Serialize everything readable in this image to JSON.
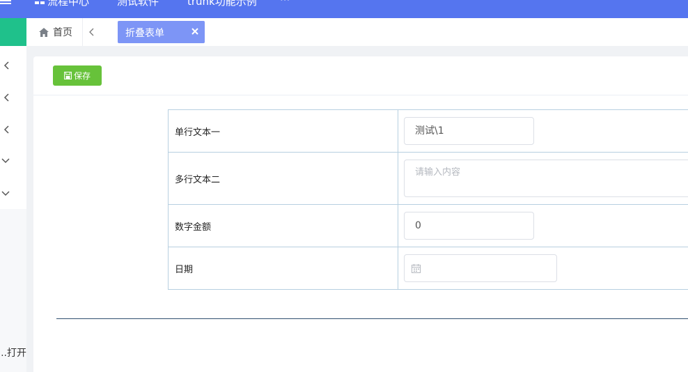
{
  "topbar": {
    "menu": [
      "流程中心",
      "测试软件",
      "trunk功能示例",
      "···"
    ]
  },
  "tabs": {
    "home_label": "首页",
    "active_label": "折叠表单"
  },
  "toolbar": {
    "save_label": "保存"
  },
  "form": {
    "rows": [
      {
        "label": "单行文本一",
        "value": "测试\\1"
      },
      {
        "label": "多行文本二",
        "placeholder": "请输入内容"
      },
      {
        "label": "数字金额",
        "value": "0"
      },
      {
        "label": "日期",
        "value": ""
      }
    ]
  },
  "sidebar": {
    "bottom_text": "打开..."
  },
  "colors": {
    "topbar": "#5575ef",
    "active_tab": "#7d95f6",
    "save_button": "#67c23a",
    "logo_strip": "#1fc18b"
  }
}
